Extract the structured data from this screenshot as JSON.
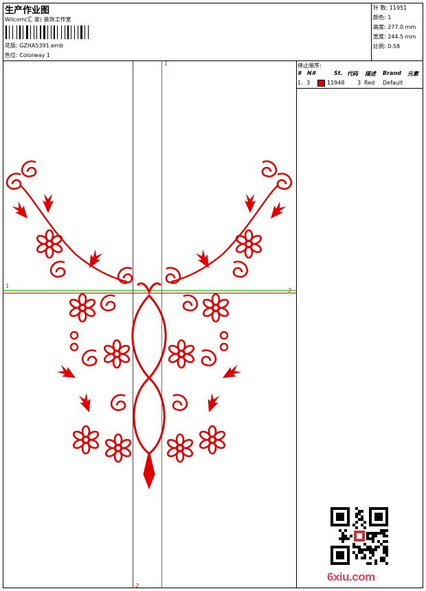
{
  "header": {
    "title": "生产作业图",
    "subtitle": "Wilcom(汇 家) 装饰工作室",
    "design_line": "花版:  GZHA5391.emb",
    "color_line": "色位:  Colorway 1"
  },
  "stats": {
    "stitches": "针 数:  11951",
    "colors": "颜色:  1",
    "height": "高度:  277.0 mm",
    "width": "宽度:  244.5 mm",
    "scale": "比例:  0.58"
  },
  "sequence": {
    "title": "停止顺序:",
    "headers": [
      "#",
      "N#",
      "St.",
      "代码",
      "描述",
      "Brand",
      "元素"
    ],
    "rows": [
      {
        "idx": "1.",
        "n": "3",
        "stitches": "11948",
        "code": "3",
        "desc": "Red",
        "brand": "Default",
        "color": "#e00000"
      }
    ]
  },
  "guides": {
    "left": "1",
    "right": "2",
    "top": "1",
    "bottom": "2"
  },
  "colors": {
    "thread": "#e00000",
    "guide_green": "#00c000",
    "guide_red": "#e00000"
  },
  "watermark": {
    "site": "6xiu.com"
  }
}
